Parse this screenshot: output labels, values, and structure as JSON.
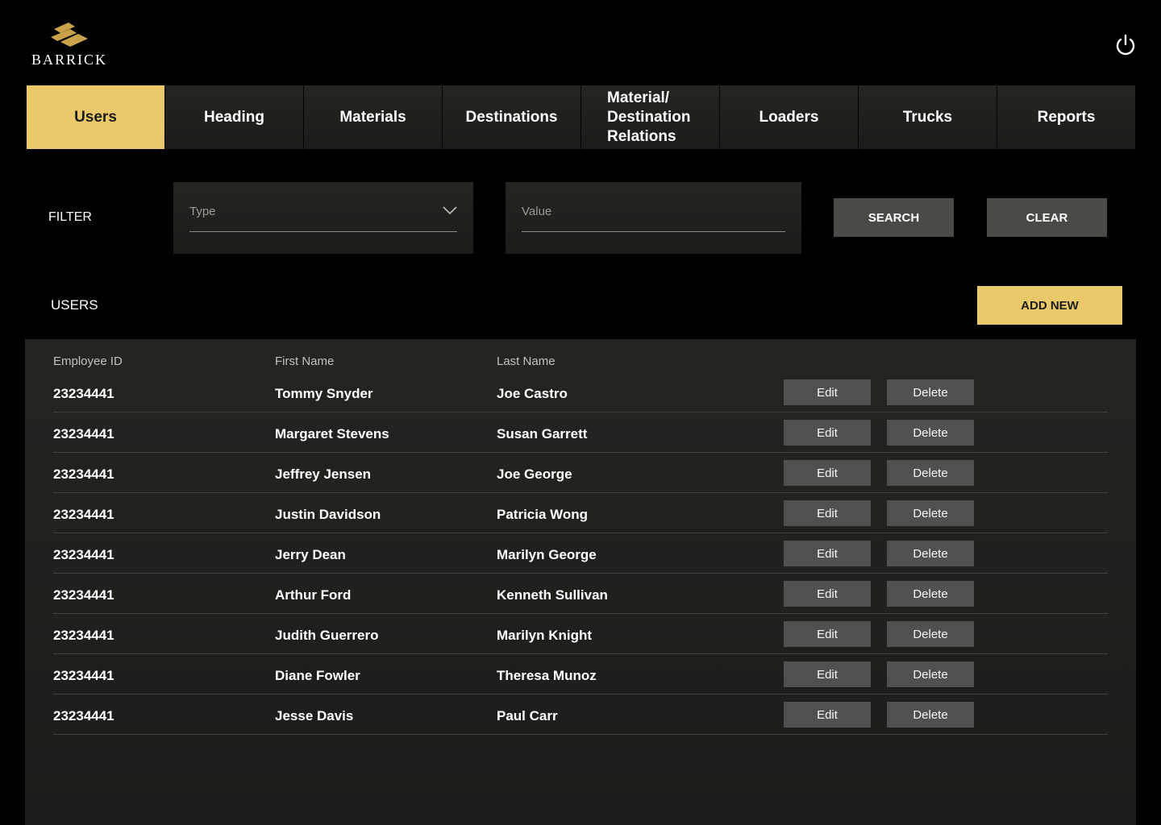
{
  "brand": {
    "logo_text": "BARRICK",
    "logo_color": "#C9A24A"
  },
  "nav": {
    "tabs": [
      {
        "label": "Users"
      },
      {
        "label": "Heading"
      },
      {
        "label": "Materials"
      },
      {
        "label": "Destinations"
      },
      {
        "label": "Material/\nDestination\nRelations"
      },
      {
        "label": "Loaders"
      },
      {
        "label": "Trucks"
      },
      {
        "label": "Reports"
      }
    ],
    "active_tab": "Users"
  },
  "filter": {
    "label": "FILTER",
    "type_placeholder": "Type",
    "value_placeholder": "Value",
    "search_label": "SEARCH",
    "clear_label": "CLEAR"
  },
  "users": {
    "section_label": "USERS",
    "add_label": "ADD NEW",
    "columns": [
      "Employee ID",
      "First Name",
      "Last Name"
    ],
    "edit_label": "Edit",
    "delete_label": "Delete",
    "rows": [
      {
        "id": "23234441",
        "first": "Tommy Snyder",
        "last": "Joe Castro"
      },
      {
        "id": "23234441",
        "first": "Margaret Stevens",
        "last": "Susan Garrett"
      },
      {
        "id": "23234441",
        "first": "Jeffrey Jensen",
        "last": "Joe George"
      },
      {
        "id": "23234441",
        "first": "Justin Davidson",
        "last": "Patricia Wong"
      },
      {
        "id": "23234441",
        "first": "Jerry Dean",
        "last": "Marilyn George"
      },
      {
        "id": "23234441",
        "first": "Arthur Ford",
        "last": "Kenneth Sullivan"
      },
      {
        "id": "23234441",
        "first": "Judith Guerrero",
        "last": "Marilyn Knight"
      },
      {
        "id": "23234441",
        "first": "Diane Fowler",
        "last": "Theresa Munoz"
      },
      {
        "id": "23234441",
        "first": "Jesse Davis",
        "last": "Paul Carr"
      }
    ]
  },
  "icons": {
    "power": "power-icon",
    "dropdown": "chevron-down-icon",
    "logo": "barrick-logo-icon"
  },
  "colors": {
    "accent": "#E9C96A",
    "panel_top": "#242421",
    "panel_bottom": "#1C1C1A",
    "row_border": "#404040",
    "row_button": "#50504F",
    "header_text": "#C1C1C1"
  }
}
